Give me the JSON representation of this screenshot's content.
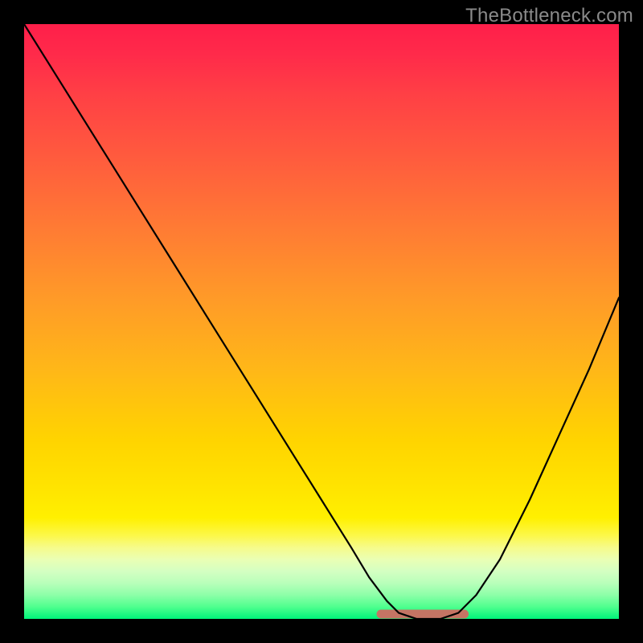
{
  "watermark": "TheBottleneck.com",
  "colors": {
    "frame": "#000000",
    "curve": "#000000",
    "floor_segment": "#c57464",
    "gradient_stops": [
      "#ff1f4a",
      "#ff2a4a",
      "#ff4045",
      "#ff5a3e",
      "#ff7a34",
      "#ff9a28",
      "#ffb718",
      "#ffd400",
      "#ffe400",
      "#fff000",
      "#fcf84a",
      "#f6fb8a",
      "#eaffb4",
      "#d4ffc2",
      "#b8ffba",
      "#8cffa8",
      "#4eff8e",
      "#00f37a"
    ]
  },
  "chart_data": {
    "type": "line",
    "title": "",
    "xlabel": "",
    "ylabel": "",
    "xlim": [
      0,
      100
    ],
    "ylim": [
      0,
      100
    ],
    "note": "No visible axis ticks or numeric labels. Values are pixel-read estimates of a V-shaped bottleneck curve with minimum around x≈63–73 at y≈0. A short salmon-colored segment marks the floor near the minimum.",
    "series": [
      {
        "name": "bottleneck-curve",
        "x": [
          0,
          5,
          10,
          15,
          20,
          25,
          30,
          35,
          40,
          45,
          50,
          55,
          58,
          61,
          63,
          66,
          70,
          73,
          76,
          80,
          85,
          90,
          95,
          100
        ],
        "y": [
          100,
          92,
          84,
          76,
          68,
          60,
          52,
          44,
          36,
          28,
          20,
          12,
          7,
          3,
          1,
          0,
          0,
          1,
          4,
          10,
          20,
          31,
          42,
          54
        ]
      }
    ],
    "floor_marker": {
      "x_start": 60,
      "x_end": 74,
      "y": 0
    }
  }
}
